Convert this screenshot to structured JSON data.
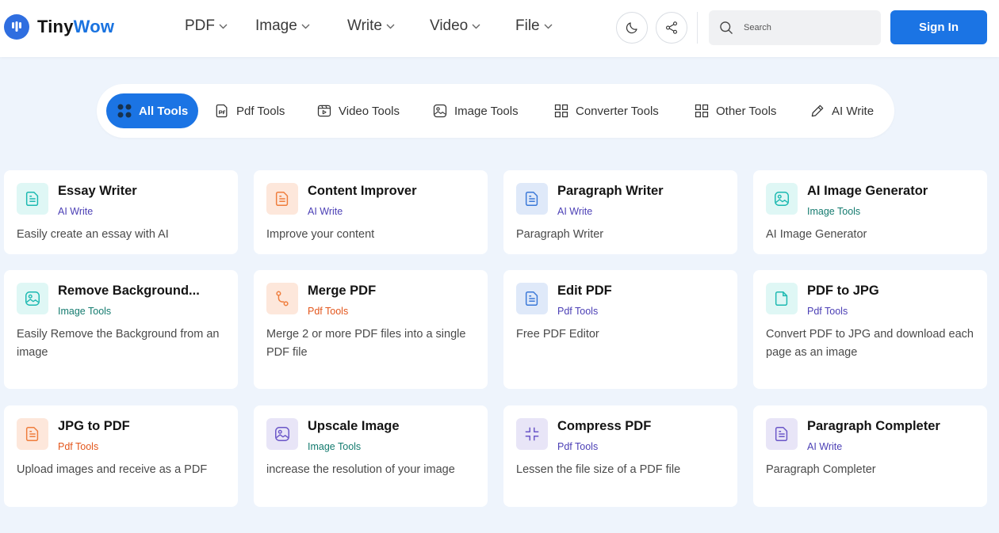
{
  "brand": {
    "name_part1": "Tiny",
    "name_part2": "Wow",
    "logo_icon": "tinywow-logo-icon"
  },
  "nav": [
    {
      "label": "PDF"
    },
    {
      "label": "Image"
    },
    {
      "label": "Write"
    },
    {
      "label": "Video"
    },
    {
      "label": "File"
    }
  ],
  "header": {
    "theme_icon": "moon-icon",
    "share_icon": "share-icon",
    "search_placeholder": "Search",
    "sign_in_label": "Sign In"
  },
  "tabs": [
    {
      "label": "All Tools",
      "icon": "grid-dots-icon",
      "active": true
    },
    {
      "label": "Pdf Tools",
      "icon": "pdf-doc-icon",
      "active": false
    },
    {
      "label": "Video Tools",
      "icon": "video-icon",
      "active": false
    },
    {
      "label": "Image Tools",
      "icon": "image-icon",
      "active": false
    },
    {
      "label": "Converter Tools",
      "icon": "grid-squares-icon",
      "active": false
    },
    {
      "label": "Other Tools",
      "icon": "grid-squares-icon",
      "active": false
    },
    {
      "label": "AI Write",
      "icon": "pencil-icon",
      "active": false
    }
  ],
  "cards": [
    {
      "title": "Essay Writer",
      "category": "AI Write",
      "description": "Easily create an essay with AI",
      "icon": "document-icon",
      "icon_color": "#1cb9b1"
    },
    {
      "title": "Content Improver",
      "category": "AI Write",
      "description": "Improve your content",
      "icon": "document-icon",
      "icon_color": "#ef7d3c"
    },
    {
      "title": "Paragraph Writer",
      "category": "AI Write",
      "description": "Paragraph Writer",
      "icon": "document-icon",
      "icon_color": "#3a78d8"
    },
    {
      "title": "AI Image Generator",
      "category": "Image Tools",
      "description": "AI Image Generator",
      "icon": "image-icon",
      "icon_color": "#1cb9b1"
    },
    {
      "title": "Remove Background...",
      "category": "Image Tools",
      "description": "Easily Remove the Background from an image",
      "icon": "image-icon",
      "icon_color": "#1cb9b1"
    },
    {
      "title": "Merge PDF",
      "category": "Pdf Tools",
      "description": "Merge 2 or more PDF files into a single PDF file",
      "icon": "merge-icon",
      "icon_color": "#ef7d3c"
    },
    {
      "title": "Edit PDF",
      "category": "Pdf Tools",
      "description": "Free PDF Editor",
      "icon": "document-icon",
      "icon_color": "#3a78d8"
    },
    {
      "title": "PDF to JPG",
      "category": "Pdf Tools",
      "description": "Convert PDF to JPG and download each page as an image",
      "icon": "file-icon",
      "icon_color": "#1cb9b1"
    },
    {
      "title": "JPG to PDF",
      "category": "Pdf Tools",
      "description": "Upload images and receive as a PDF",
      "icon": "document-icon",
      "icon_color": "#ef7d3c"
    },
    {
      "title": "Upscale Image",
      "category": "Image Tools",
      "description": "increase the resolution of your image",
      "icon": "image-icon",
      "icon_color": "#6a56c8"
    },
    {
      "title": "Compress PDF",
      "category": "Pdf Tools",
      "description": "Lessen the file size of a PDF file",
      "icon": "compress-icon",
      "icon_color": "#6a56c8"
    },
    {
      "title": "Paragraph Completer",
      "category": "AI Write",
      "description": "Paragraph Completer",
      "icon": "document-icon",
      "icon_color": "#6a56c8"
    }
  ],
  "category_colors": {
    "AI Write": "#4b3fb5",
    "Image Tools": "#147b6f",
    "Pdf Tools": "#e3561c"
  }
}
